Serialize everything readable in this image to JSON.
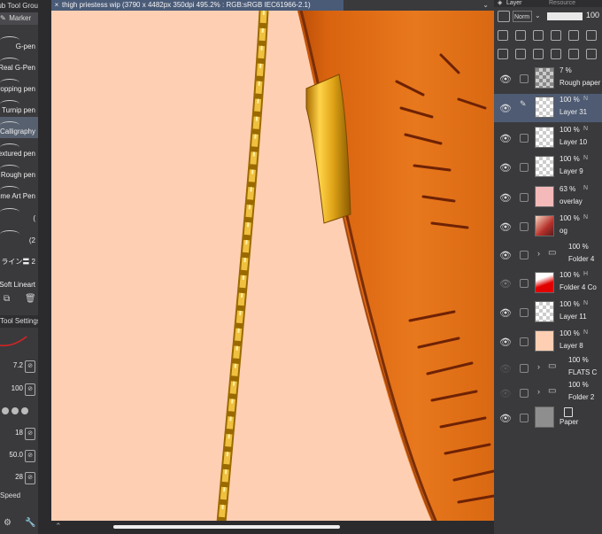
{
  "left_panel": {
    "group_title": "Sub Tool Group",
    "tab_label": "Marker",
    "brushes": [
      {
        "label": "G-pen"
      },
      {
        "label": "Real G-Pen"
      },
      {
        "label": "Dropping pen"
      },
      {
        "label": "Turnip pen"
      },
      {
        "label": "Calligraphy",
        "selected": true
      },
      {
        "label": "Textured pen"
      },
      {
        "label": "Rough pen"
      },
      {
        "label": "Anime Art Pen"
      },
      {
        "label": "("
      },
      {
        "label": "(2"
      },
      {
        "label": "ライン〓 2"
      },
      {
        "label": "Soft Lineart"
      }
    ],
    "tool_settings_title": "Tool Settings",
    "properties": [
      "7.2",
      "100",
      "",
      "18",
      "50.0",
      "28"
    ],
    "bottom_label": "Speed"
  },
  "document": {
    "title": "thigh priestess wip (3790 x 4482px 350dpi 495.2% : RGB:sRGB IEC61966-2.1)"
  },
  "layer_panel": {
    "tabs": [
      "Layer",
      "Resource"
    ],
    "blend_mode": "Norm",
    "opacity": "100",
    "layers": [
      {
        "opacity": "7 %",
        "name": "Rough paper",
        "mode": "",
        "thumb": "paper"
      },
      {
        "opacity": "100 %",
        "name": "Layer 31",
        "mode": "N",
        "thumb": "empty",
        "selected": true
      },
      {
        "opacity": "100 %",
        "name": "Layer 10",
        "mode": "N",
        "thumb": "empty"
      },
      {
        "opacity": "100 %",
        "name": "Layer 9",
        "mode": "N",
        "thumb": "empty"
      },
      {
        "opacity": "63 %",
        "name": "overlay",
        "mode": "N",
        "thumb": "pink"
      },
      {
        "opacity": "100 %",
        "name": "og",
        "mode": "N",
        "thumb": "og"
      },
      {
        "opacity": "100 %",
        "name": "Folder 4",
        "mode": "",
        "thumb": "folder"
      },
      {
        "opacity": "100 %",
        "name": "Folder 4 Co",
        "mode": "H",
        "thumb": "red"
      },
      {
        "opacity": "100 %",
        "name": "Layer 11",
        "mode": "N",
        "thumb": "empty"
      },
      {
        "opacity": "100 %",
        "name": "Layer 8",
        "mode": "N",
        "thumb": "peach"
      },
      {
        "opacity": "100 %",
        "name": "FLATS C",
        "mode": "",
        "thumb": "folder"
      },
      {
        "opacity": "100 %",
        "name": "Folder 2",
        "mode": "",
        "thumb": "folder"
      },
      {
        "opacity": "",
        "name": "Paper",
        "mode": "",
        "thumb": "gray"
      }
    ]
  },
  "colors": {
    "canvas_bg": "#ffcfb3",
    "cloth": "#e0701a",
    "gold": "#d4a017",
    "selection": "#4e5b73"
  }
}
